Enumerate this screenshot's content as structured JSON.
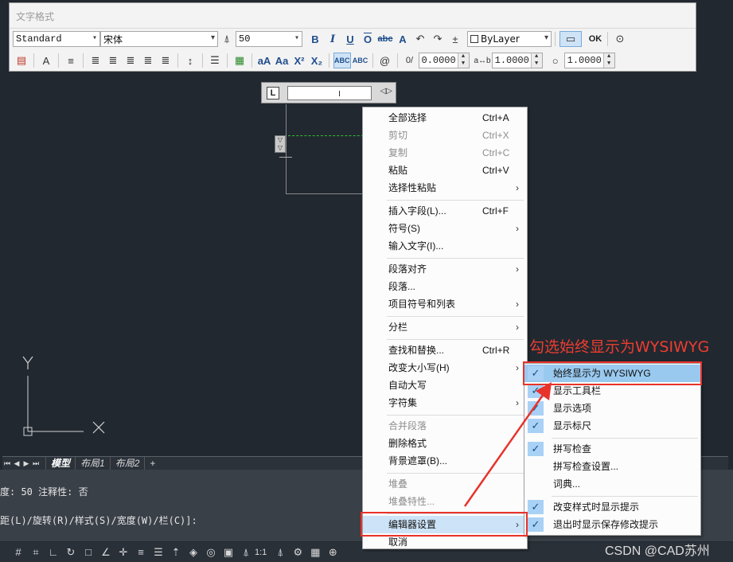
{
  "toolbar": {
    "title": "文字格式",
    "style_value": "Standard",
    "font_value": "宋体",
    "height_value": "50",
    "color_value": "ByLayer",
    "ok_label": "OK",
    "oblique_value": "0.0000",
    "tracking_value": "1.0000",
    "width_value": "1.0000",
    "bold_label": "B",
    "italic_label": "I",
    "underline_label": "U",
    "overline_label": "O",
    "strike_label": "abc"
  },
  "ruler": {
    "l_label": "L"
  },
  "tabs": {
    "items": [
      "模型",
      "布局1",
      "布局2",
      "+"
    ]
  },
  "command": {
    "line1": "度:  50  注释性:  否",
    "line2": "距(L)/旋转(R)/样式(S)/宽度(W)/栏(C)]:"
  },
  "status_bar": {
    "scale_label": "1:1"
  },
  "context_menu": {
    "items": [
      {
        "label": "全部选择",
        "shortcut": "Ctrl+A"
      },
      {
        "label": "剪切",
        "shortcut": "Ctrl+X"
      },
      {
        "label": "复制",
        "shortcut": "Ctrl+C"
      },
      {
        "label": "粘贴",
        "shortcut": "Ctrl+V"
      },
      {
        "label": "选择性粘贴"
      },
      {
        "label": "插入字段(L)...",
        "shortcut": "Ctrl+F"
      },
      {
        "label": "符号(S)"
      },
      {
        "label": "输入文字(I)..."
      },
      {
        "label": "段落对齐"
      },
      {
        "label": "段落..."
      },
      {
        "label": "项目符号和列表"
      },
      {
        "label": "分栏"
      },
      {
        "label": "查找和替换...",
        "shortcut": "Ctrl+R"
      },
      {
        "label": "改变大小写(H)"
      },
      {
        "label": "自动大写"
      },
      {
        "label": "字符集"
      },
      {
        "label": "合并段落"
      },
      {
        "label": "删除格式"
      },
      {
        "label": "背景遮罩(B)..."
      },
      {
        "label": "堆叠"
      },
      {
        "label": "堆叠特性..."
      },
      {
        "label": "编辑器设置"
      },
      {
        "label": "取消"
      }
    ]
  },
  "submenu": {
    "items": [
      {
        "label": "始终显示为 WYSIWYG"
      },
      {
        "label": "显示工具栏"
      },
      {
        "label": "显示选项"
      },
      {
        "label": "显示标尺"
      },
      {
        "label": "拼写检查"
      },
      {
        "label": "拼写检查设置..."
      },
      {
        "label": "词典..."
      },
      {
        "label": "改变样式时显示提示"
      },
      {
        "label": "退出时显示保存修改提示"
      }
    ]
  },
  "annotation": {
    "text": "勾选始终显示为WYSIWYG"
  },
  "watermark": "CSDN @CAD苏州",
  "colors": {
    "annotation_red": "#e8332b",
    "canvas_bg": "#212830",
    "highlight_blue": "#99c9ef"
  }
}
